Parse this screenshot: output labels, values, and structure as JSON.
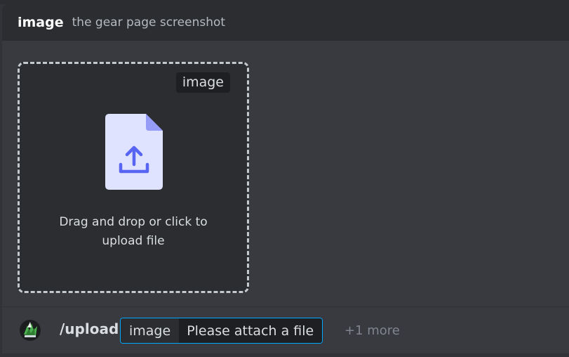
{
  "header": {
    "option_name": "image",
    "option_description": "the gear page screenshot"
  },
  "dropzone": {
    "tag": "image",
    "text": "Drag and drop or click to upload file",
    "icon": "file-upload-icon"
  },
  "command_bar": {
    "avatar_icon": "user-avatar",
    "command": "/upload",
    "option_name": "image",
    "option_placeholder": "Please attach a file",
    "more": "+1 more"
  },
  "colors": {
    "accent_blue": "#00a8fc",
    "icon_lavender": "#e0e3ff",
    "icon_fold": "#949cf7",
    "icon_arrow": "#5865f2"
  }
}
